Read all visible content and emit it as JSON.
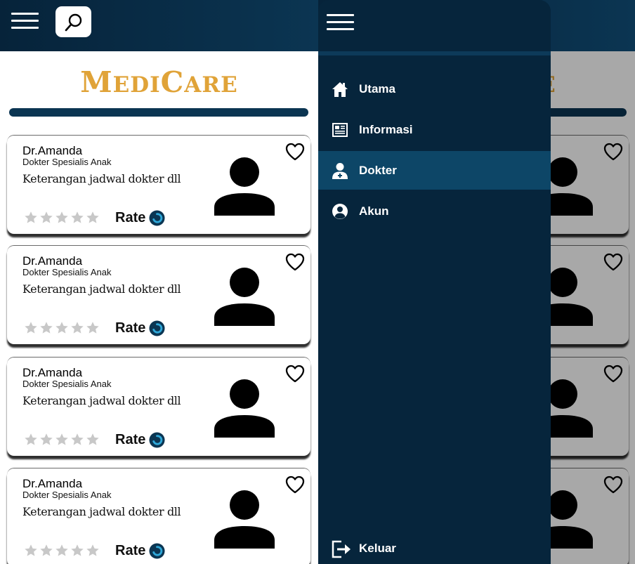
{
  "app": {
    "logo_first_big": "M",
    "logo_first_small": "EDI",
    "logo_second_big": "C",
    "logo_second_small": "ARE"
  },
  "colors": {
    "navy": "#06233a",
    "accent_blue": "#0b3552",
    "logo_gold": "#e0a338",
    "active_item": "#0d4667"
  },
  "cards": [
    {
      "name": "Dr.Amanda",
      "specialty": "Dokter Spesialis Anak",
      "info": "Keterangan jadwal dokter dll",
      "rate_label": "Rate",
      "rating": 0
    },
    {
      "name": "Dr.Amanda",
      "specialty": "Dokter Spesialis Anak",
      "info": "Keterangan jadwal dokter dll",
      "rate_label": "Rate",
      "rating": 0
    },
    {
      "name": "Dr.Amanda",
      "specialty": "Dokter Spesialis Anak",
      "info": "Keterangan jadwal dokter dll",
      "rate_label": "Rate",
      "rating": 0
    },
    {
      "name": "Dr.Amanda",
      "specialty": "Dokter Spesialis Anak",
      "info": "Keterangan jadwal dokter dll",
      "rate_label": "Rate",
      "rating": 0
    }
  ],
  "drawer": {
    "items": [
      {
        "label": "Utama",
        "icon": "home-icon"
      },
      {
        "label": "Informasi",
        "icon": "news-icon"
      },
      {
        "label": "Dokter",
        "icon": "doctor-icon",
        "active": true
      },
      {
        "label": "Akun",
        "icon": "account-icon"
      }
    ],
    "logout": {
      "label": "Keluar",
      "icon": "logout-icon"
    }
  }
}
